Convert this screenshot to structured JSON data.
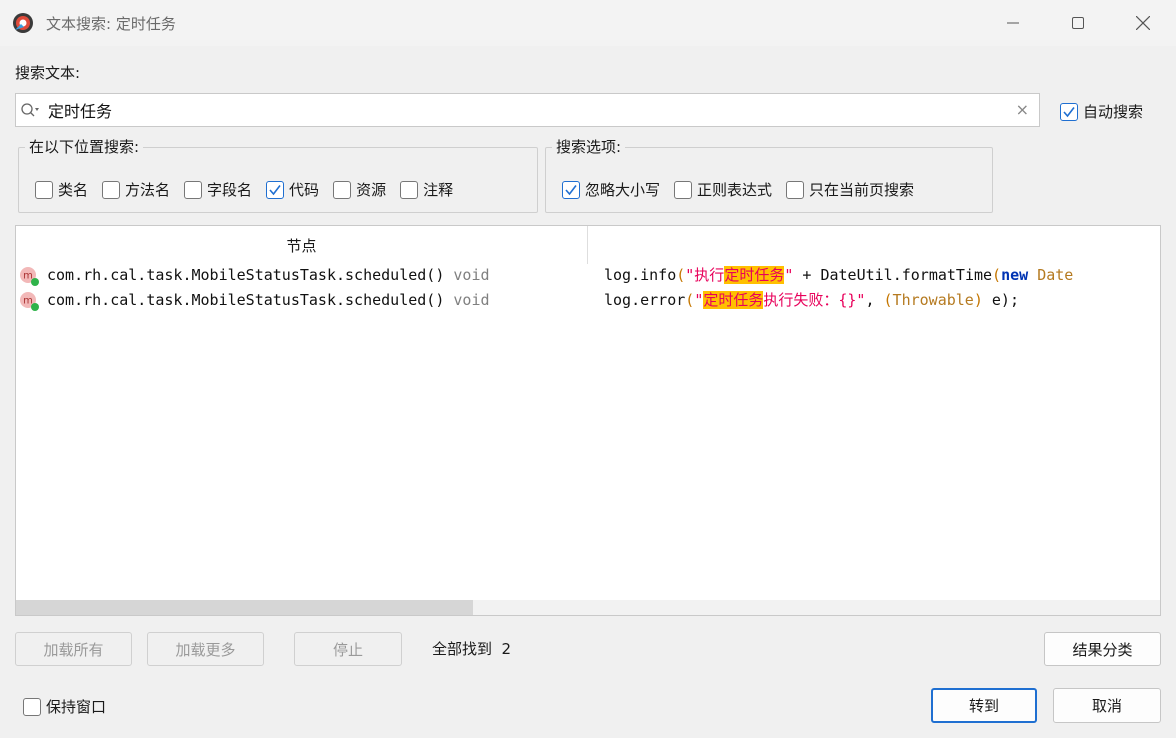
{
  "window": {
    "title": "文本搜索: 定时任务"
  },
  "search": {
    "label": "搜索文本:",
    "value": "定时任务",
    "clear_glyph": "×",
    "auto_search": {
      "label": "自动搜索",
      "checked": true
    }
  },
  "scope_group": {
    "legend": "在以下位置搜索:",
    "options": [
      {
        "label": "类名",
        "checked": false
      },
      {
        "label": "方法名",
        "checked": false
      },
      {
        "label": "字段名",
        "checked": false
      },
      {
        "label": "代码",
        "checked": true
      },
      {
        "label": "资源",
        "checked": false
      },
      {
        "label": "注释",
        "checked": false
      }
    ]
  },
  "options_group": {
    "legend": "搜索选项:",
    "options": [
      {
        "label": "忽略大小写",
        "checked": true
      },
      {
        "label": "正则表达式",
        "checked": false
      },
      {
        "label": "只在当前页搜索",
        "checked": false
      }
    ]
  },
  "results": {
    "columns": [
      "节点",
      ""
    ],
    "rows": [
      {
        "icon": "method-icon",
        "node": "com.rh.cal.task.MobileStatusTask.scheduled()",
        "return_type": "void",
        "code": [
          {
            "t": "log.info",
            "s": ""
          },
          {
            "t": "(",
            "s": "paren"
          },
          {
            "t": "\"执行",
            "s": "str"
          },
          {
            "t": "定时任务",
            "s": "hl"
          },
          {
            "t": "\"",
            "s": "str"
          },
          {
            "t": " + DateUtil.formatTime",
            "s": ""
          },
          {
            "t": "(",
            "s": "paren"
          },
          {
            "t": "new",
            "s": "kw"
          },
          {
            "t": " Date",
            "s": "typ"
          }
        ]
      },
      {
        "icon": "method-icon",
        "node": "com.rh.cal.task.MobileStatusTask.scheduled()",
        "return_type": "void",
        "code": [
          {
            "t": "log.error",
            "s": ""
          },
          {
            "t": "(",
            "s": "paren"
          },
          {
            "t": "\"",
            "s": "str"
          },
          {
            "t": "定时任务",
            "s": "hl"
          },
          {
            "t": "执行失败：{}\"",
            "s": "str"
          },
          {
            "t": ", ",
            "s": ""
          },
          {
            "t": "(",
            "s": "paren"
          },
          {
            "t": "Throwable",
            "s": "typ"
          },
          {
            "t": ")",
            "s": "paren"
          },
          {
            "t": " e);",
            "s": ""
          }
        ]
      }
    ]
  },
  "buttons": {
    "load_all": "加载所有",
    "load_more": "加载更多",
    "stop": "停止",
    "group_results": "结果分类",
    "goto": "转到",
    "cancel": "取消"
  },
  "status": {
    "found_text": "全部找到  2"
  },
  "keep_window": {
    "label": "保持窗口",
    "checked": false
  },
  "colors": {
    "accent": "#1f6fd1",
    "highlight_bg": "#ffc000",
    "string": "#e8005a",
    "keyword": "#0033b3"
  }
}
